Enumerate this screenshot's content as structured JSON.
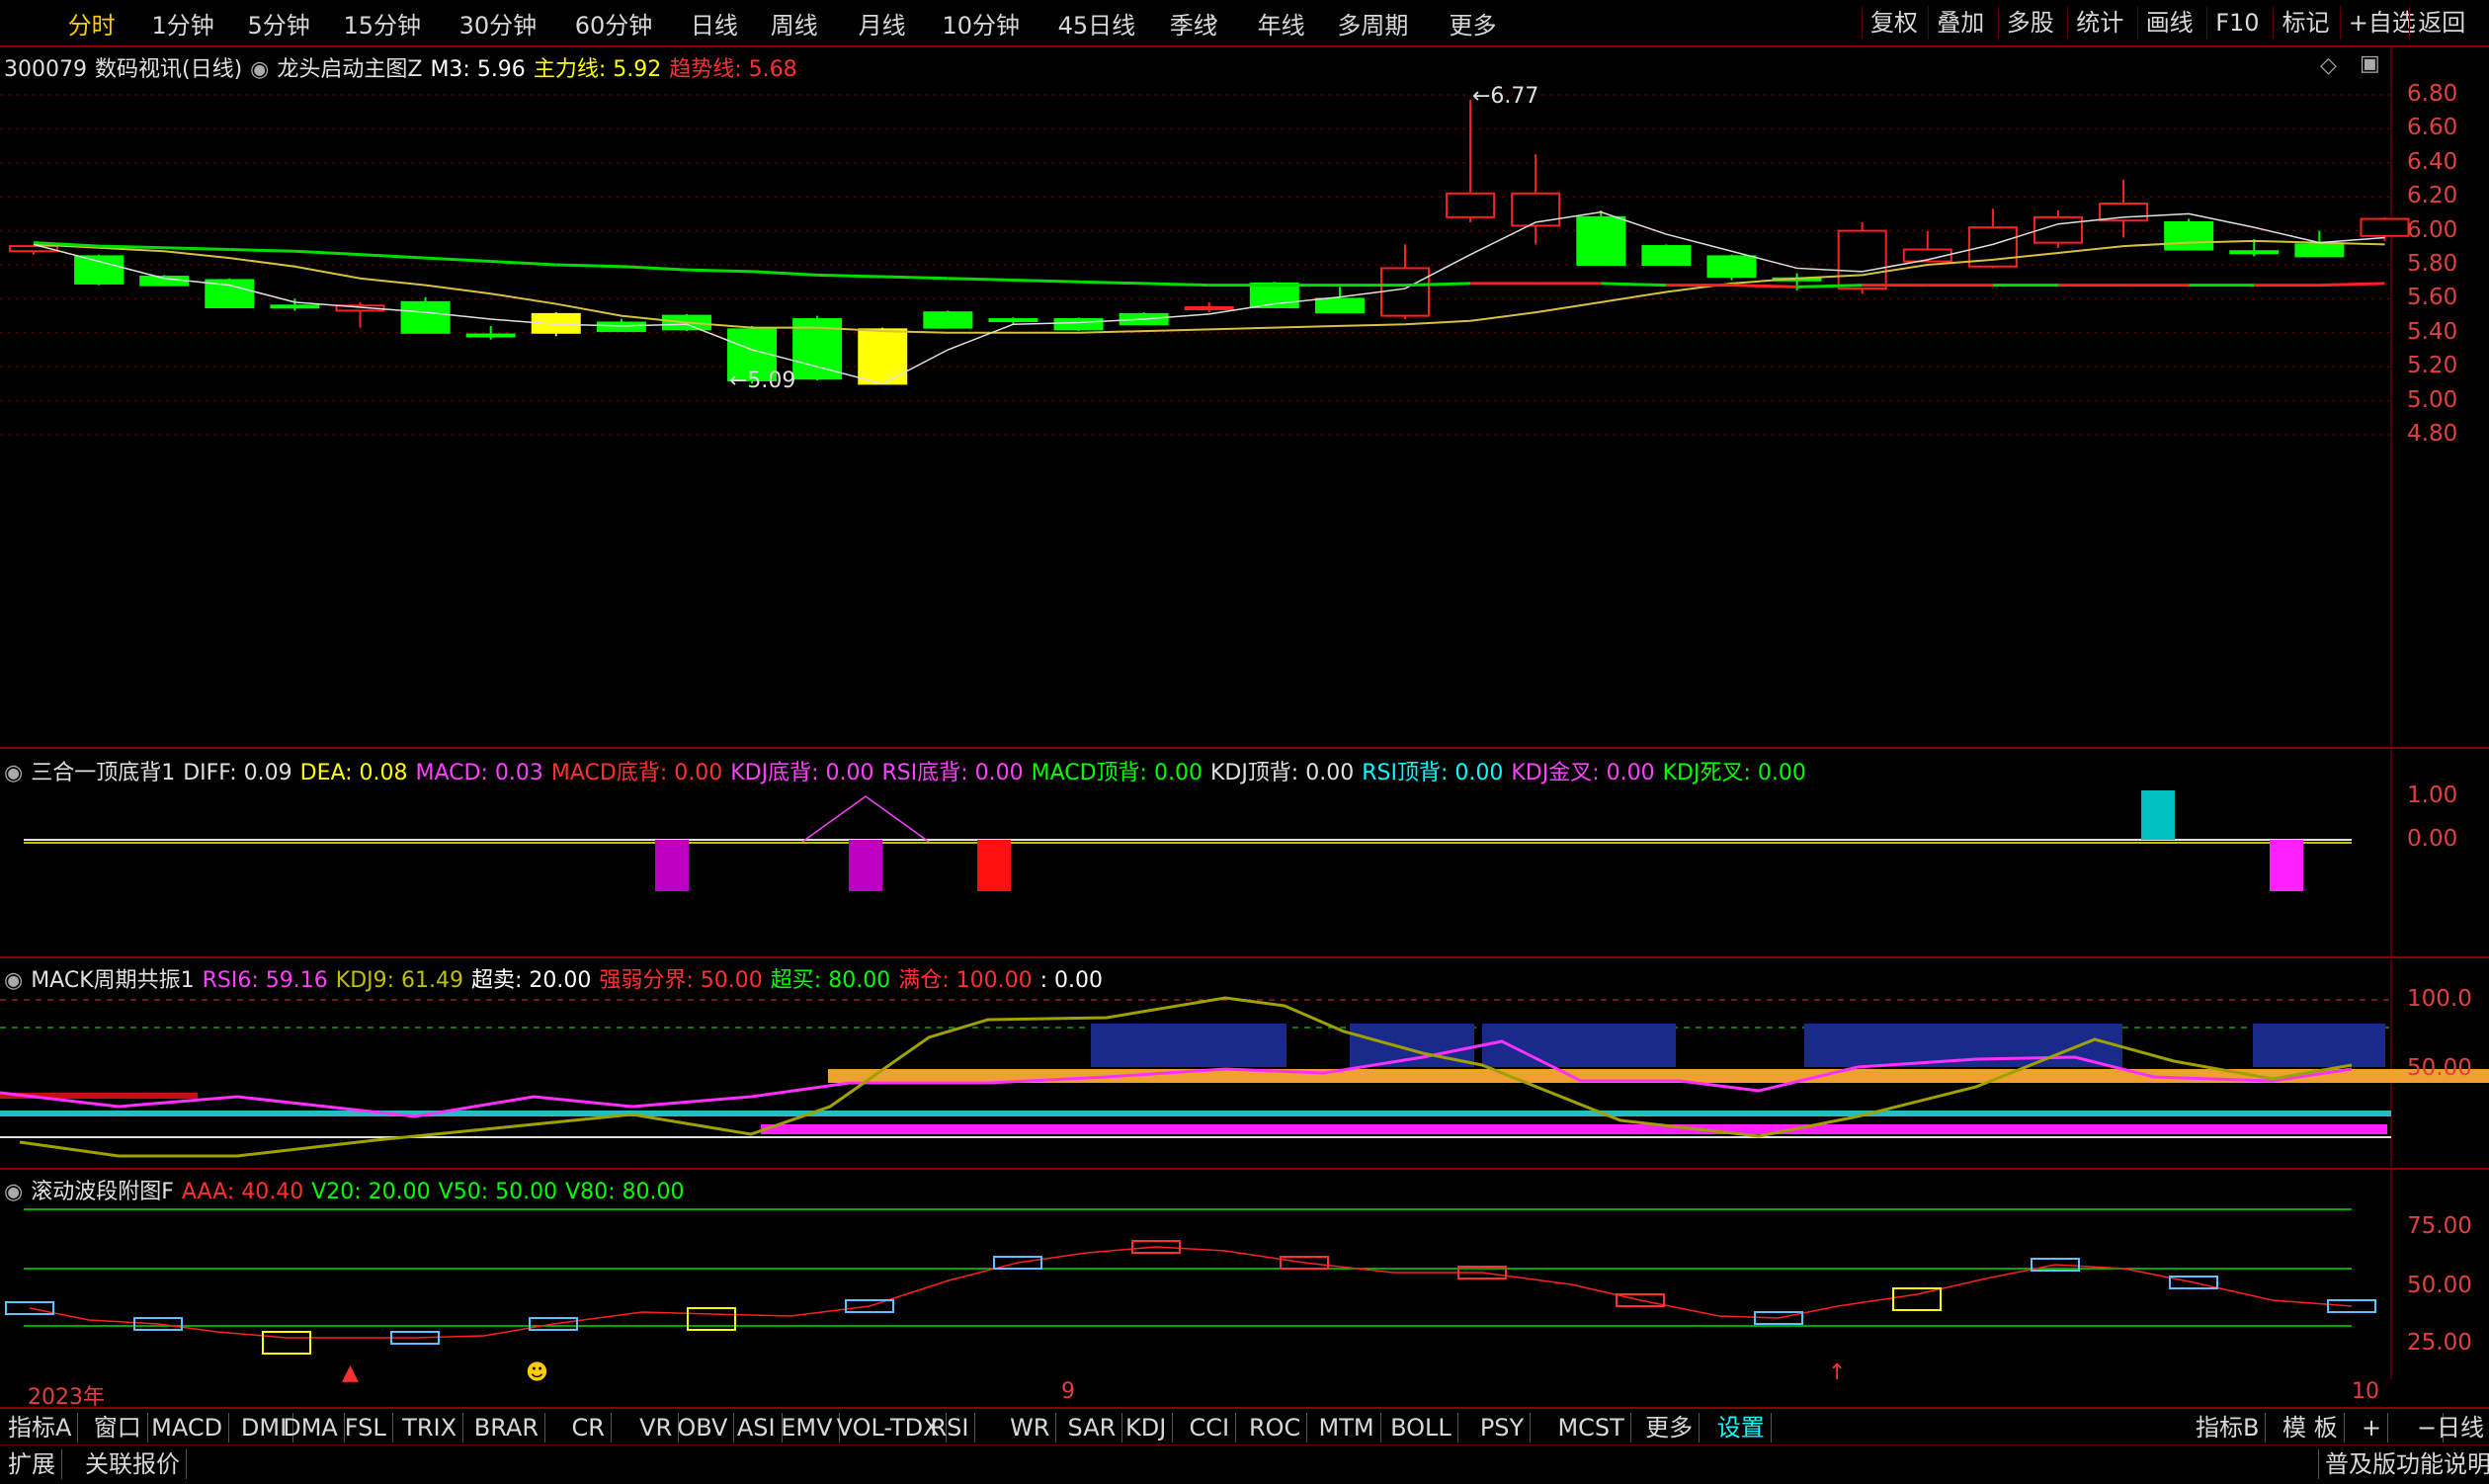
{
  "topbar": {
    "periods": [
      "分时",
      "1分钟",
      "5分钟",
      "15分钟",
      "30分钟",
      "60分钟",
      "日线",
      "周线",
      "月线",
      "10分钟",
      "45日线",
      "季线",
      "年线",
      "多周期",
      "更多"
    ],
    "active_period": "分时",
    "right_buttons": [
      "复权",
      "叠加",
      "多股",
      "统计",
      "画线",
      "F10",
      "标记",
      "+自选",
      "返回"
    ]
  },
  "main_panel": {
    "stock_code": "300079",
    "stock_name": "数码视讯(日线)",
    "indicator": "龙头启动主图Z",
    "m3": "M3: 5.96",
    "zhuli": "主力线: 5.92",
    "qushi": "趋势线: 5.68",
    "price_high_label": "6.77",
    "price_low_label": "5.09",
    "y_ticks": [
      "6.80",
      "6.60",
      "6.40",
      "6.20",
      "6.00",
      "5.80",
      "5.60",
      "5.40",
      "5.20",
      "5.00",
      "4.80"
    ]
  },
  "macd_panel": {
    "name": "三合一顶底背1",
    "items": [
      {
        "label": "DIFF: 0.09",
        "color": "#e0e0e0"
      },
      {
        "label": "DEA: 0.08",
        "color": "#ffff00"
      },
      {
        "label": "MACD: 0.03",
        "color": "#ff40ff"
      },
      {
        "label": "MACD底背: 0.00",
        "color": "#ff3030"
      },
      {
        "label": "KDJ底背: 0.00",
        "color": "#ff40ff"
      },
      {
        "label": "RSI底背: 0.00",
        "color": "#ff40ff"
      },
      {
        "label": "MACD顶背: 0.00",
        "color": "#00ff00"
      },
      {
        "label": "KDJ顶背: 0.00",
        "color": "#e0e0e0"
      },
      {
        "label": "RSI顶背: 0.00",
        "color": "#00ffff"
      },
      {
        "label": "KDJ金叉: 0.00",
        "color": "#ff40ff"
      },
      {
        "label": "KDJ死叉: 0.00",
        "color": "#00ff00"
      }
    ],
    "y_ticks": [
      "1.00",
      "0.00"
    ]
  },
  "mack_panel": {
    "name": "MACK周期共振1",
    "items": [
      {
        "label": "RSI6: 59.16",
        "color": "#ff40ff"
      },
      {
        "label": "KDJ9: 61.49",
        "color": "#c0c000"
      },
      {
        "label": "超卖: 20.00",
        "color": "#ffffff"
      },
      {
        "label": "强弱分界: 50.00",
        "color": "#ff3030"
      },
      {
        "label": "超买: 80.00",
        "color": "#00ff00"
      },
      {
        "label": "满仓: 100.00",
        "color": "#ff3030"
      },
      {
        "label": ": 0.00",
        "color": "#ffffff"
      }
    ],
    "y_ticks": [
      "100.0",
      "50.00"
    ]
  },
  "wave_panel": {
    "name": "滚动波段附图F",
    "items": [
      {
        "label": "AAA: 40.40",
        "color": "#ff3030"
      },
      {
        "label": "V20: 20.00",
        "color": "#00ff00"
      },
      {
        "label": "V50: 50.00",
        "color": "#00ff00"
      },
      {
        "label": "V80: 80.00",
        "color": "#00ff00"
      }
    ],
    "y_ticks": [
      "75.00",
      "50.00",
      "25.00"
    ]
  },
  "time_axis": {
    "year": "2023年",
    "month1": "9",
    "month2": "10"
  },
  "bottombar": {
    "left_label": "指标A",
    "items": [
      "窗口",
      "MACD",
      "DMI",
      "DMA",
      "FSL",
      "TRIX",
      "BRAR",
      "CR",
      "VR",
      "OBV",
      "ASI",
      "EMV",
      "VOL-TDX",
      "RSI",
      "WR",
      "SAR",
      "KDJ",
      "CCI",
      "ROC",
      "MTM",
      "BOLL",
      "PSY",
      "MCST",
      "更多",
      "设置"
    ],
    "right_items": [
      "指标B",
      "模 板",
      "+",
      "−"
    ],
    "corner": "日线"
  },
  "statusbar": {
    "left": [
      "扩展",
      "关联报价"
    ],
    "right": "普及版功能说明"
  },
  "colors": {
    "up": "#ff2020",
    "down": "#00ff00",
    "grid": "#8a0000",
    "bg": "#000000"
  }
}
